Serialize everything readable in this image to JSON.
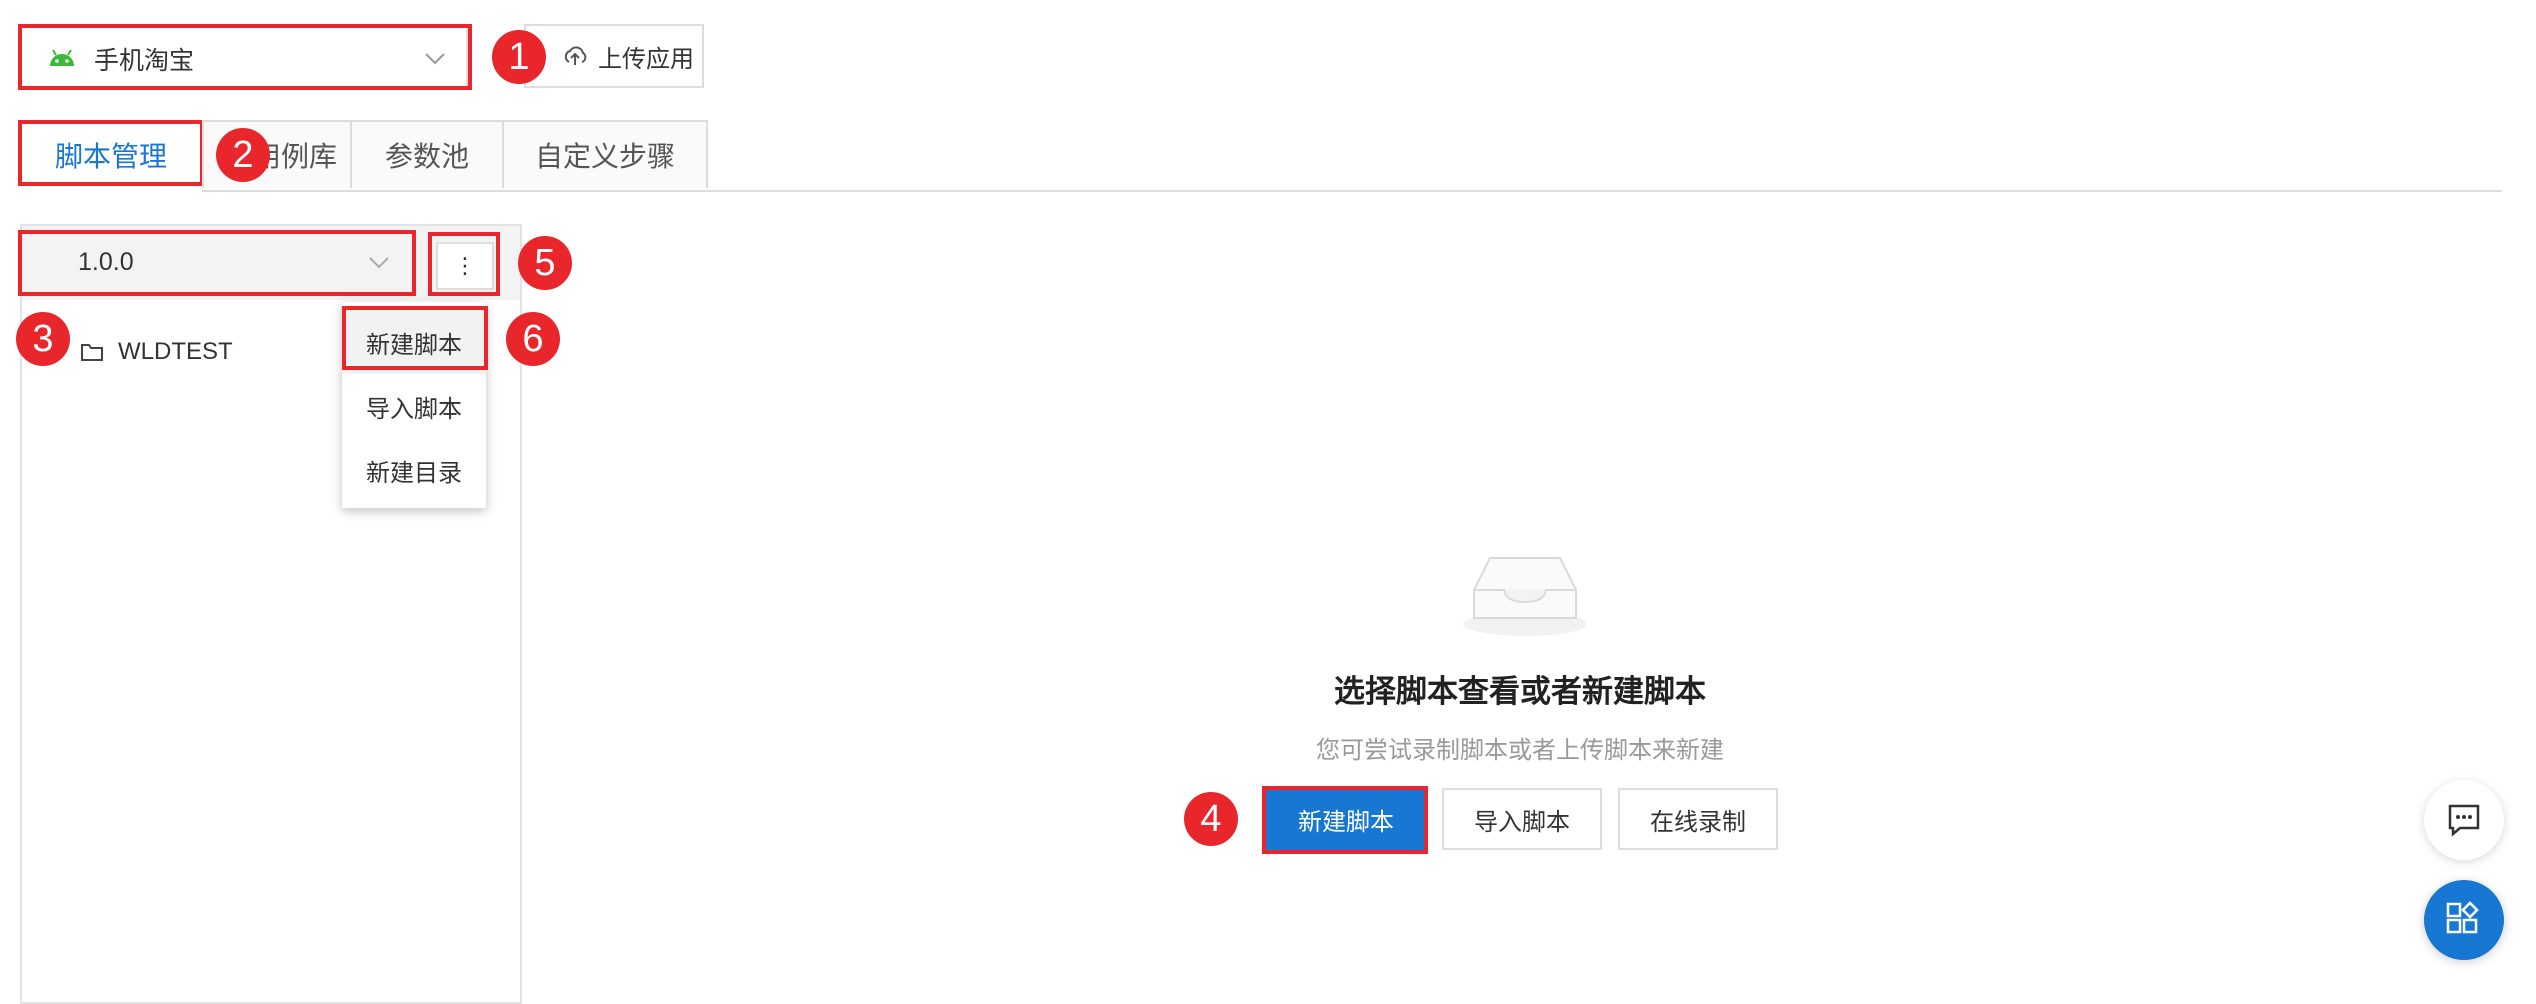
{
  "app_select": {
    "value": "手机淘宝",
    "icon": "android-icon"
  },
  "upload_button": {
    "label": "上传应用",
    "icon": "cloud-upload-icon"
  },
  "tabs": [
    {
      "label": "脚本管理",
      "active": true
    },
    {
      "label": "用例库",
      "active": false
    },
    {
      "label": "参数池",
      "active": false
    },
    {
      "label": "自定义步骤",
      "active": false
    }
  ],
  "version_select": {
    "value": "1.0.0"
  },
  "more_button": {
    "label": "⋮"
  },
  "dropdown_menu": [
    "新建脚本",
    "导入脚本",
    "新建目录"
  ],
  "tree": [
    {
      "label": "WLDTEST",
      "icon": "folder-icon"
    }
  ],
  "empty_state": {
    "icon": "empty-inbox-icon",
    "title": "选择脚本查看或者新建脚本",
    "subtitle": "您可尝试录制脚本或者上传脚本来新建",
    "buttons": [
      "新建脚本",
      "导入脚本",
      "在线录制"
    ]
  },
  "badges": [
    "1",
    "2",
    "3",
    "4",
    "5",
    "6"
  ],
  "floating": [
    "chat-icon",
    "apps-icon"
  ],
  "colors": {
    "primary": "#1777d2",
    "annotation_red": "#e8262b",
    "android_green": "#3ab93a"
  }
}
